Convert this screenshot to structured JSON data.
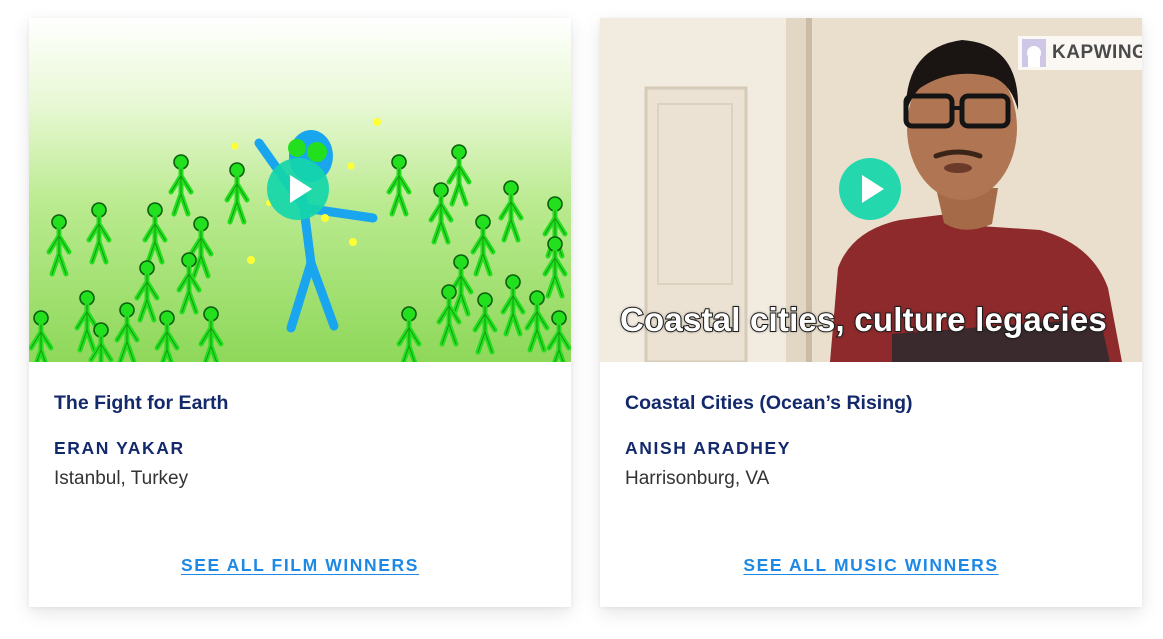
{
  "cards": [
    {
      "title": "The Fight for Earth",
      "artist": "ERAN YAKAR",
      "location": "Istanbul, Turkey",
      "link_label": "SEE ALL FILM WINNERS",
      "thumbnail_icon": "animation-stick-figures-thumbnail"
    },
    {
      "title": "Coastal Cities (Ocean’s Rising)",
      "artist": "ANISH ARADHEY",
      "location": "Harrisonburg, VA",
      "link_label": "SEE ALL MUSIC WINNERS",
      "thumbnail_icon": "video-person-thumbnail",
      "caption": "Coastal cities, culture legacies",
      "watermark": "KAPWING"
    }
  ],
  "colors": {
    "title": "#13296b",
    "link": "#1e88e5",
    "play_button": "#14d6aa"
  }
}
